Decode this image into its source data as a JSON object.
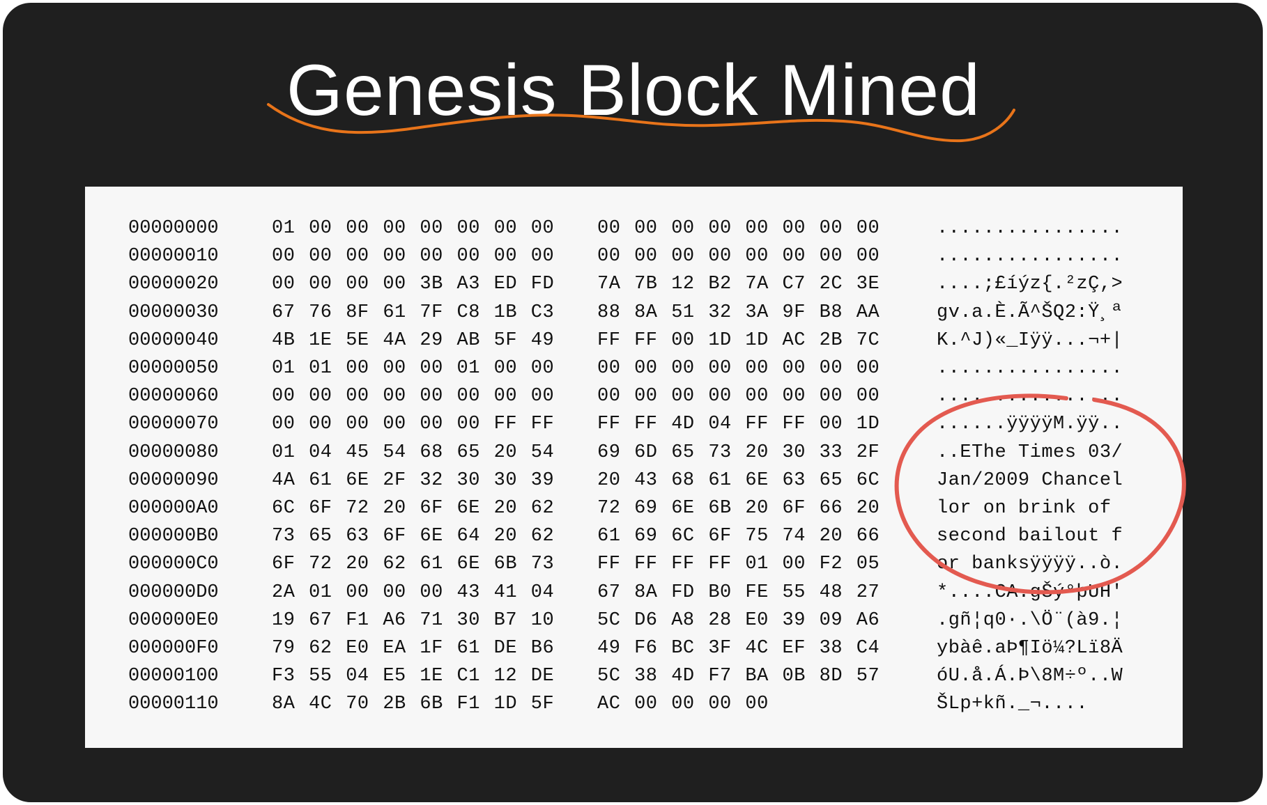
{
  "title": "Genesis Block Mined",
  "colors": {
    "background": "#1f1f1f",
    "title": "#ffffff",
    "underline_accent": "#e8741a",
    "panel": "#f7f7f7",
    "highlight_circle": "#e35a50"
  },
  "hex_rows": [
    {
      "offset": "00000000",
      "bytes1": "01 00 00 00 00 00 00 00",
      "bytes2": "00 00 00 00 00 00 00 00",
      "ascii": "................"
    },
    {
      "offset": "00000010",
      "bytes1": "00 00 00 00 00 00 00 00",
      "bytes2": "00 00 00 00 00 00 00 00",
      "ascii": "................"
    },
    {
      "offset": "00000020",
      "bytes1": "00 00 00 00 3B A3 ED FD",
      "bytes2": "7A 7B 12 B2 7A C7 2C 3E",
      "ascii": "....;£íýz{.²zÇ,>"
    },
    {
      "offset": "00000030",
      "bytes1": "67 76 8F 61 7F C8 1B C3",
      "bytes2": "88 8A 51 32 3A 9F B8 AA",
      "ascii": "gv.a.È.Ã^ŠQ2:Ÿ¸ª"
    },
    {
      "offset": "00000040",
      "bytes1": "4B 1E 5E 4A 29 AB 5F 49",
      "bytes2": "FF FF 00 1D 1D AC 2B 7C",
      "ascii": "K.^J)«_Iÿÿ...¬+|"
    },
    {
      "offset": "00000050",
      "bytes1": "01 01 00 00 00 01 00 00",
      "bytes2": "00 00 00 00 00 00 00 00",
      "ascii": "................"
    },
    {
      "offset": "00000060",
      "bytes1": "00 00 00 00 00 00 00 00",
      "bytes2": "00 00 00 00 00 00 00 00",
      "ascii": "................"
    },
    {
      "offset": "00000070",
      "bytes1": "00 00 00 00 00 00 FF FF",
      "bytes2": "FF FF 4D 04 FF FF 00 1D",
      "ascii": "......ÿÿÿÿM.ÿÿ.."
    },
    {
      "offset": "00000080",
      "bytes1": "01 04 45 54 68 65 20 54",
      "bytes2": "69 6D 65 73 20 30 33 2F",
      "ascii": "..EThe Times 03/"
    },
    {
      "offset": "00000090",
      "bytes1": "4A 61 6E 2F 32 30 30 39",
      "bytes2": "20 43 68 61 6E 63 65 6C",
      "ascii": "Jan/2009 Chancel"
    },
    {
      "offset": "000000A0",
      "bytes1": "6C 6F 72 20 6F 6E 20 62",
      "bytes2": "72 69 6E 6B 20 6F 66 20",
      "ascii": "lor on brink of "
    },
    {
      "offset": "000000B0",
      "bytes1": "73 65 63 6F 6E 64 20 62",
      "bytes2": "61 69 6C 6F 75 74 20 66",
      "ascii": "second bailout f"
    },
    {
      "offset": "000000C0",
      "bytes1": "6F 72 20 62 61 6E 6B 73",
      "bytes2": "FF FF FF FF 01 00 F2 05",
      "ascii": "or banksÿÿÿÿ..ò."
    },
    {
      "offset": "000000D0",
      "bytes1": "2A 01 00 00 00 43 41 04",
      "bytes2": "67 8A FD B0 FE 55 48 27",
      "ascii": "*....CA.gŠý°þUH'"
    },
    {
      "offset": "000000E0",
      "bytes1": "19 67 F1 A6 71 30 B7 10",
      "bytes2": "5C D6 A8 28 E0 39 09 A6",
      "ascii": ".gñ¦q0·.\\Ö¨(à9.¦"
    },
    {
      "offset": "000000F0",
      "bytes1": "79 62 E0 EA 1F 61 DE B6",
      "bytes2": "49 F6 BC 3F 4C EF 38 C4",
      "ascii": "ybàê.aÞ¶Iö¼?Lï8Ä"
    },
    {
      "offset": "00000100",
      "bytes1": "F3 55 04 E5 1E C1 12 DE",
      "bytes2": "5C 38 4D F7 BA 0B 8D 57",
      "ascii": "óU.å.Á.Þ\\8M÷º..W"
    },
    {
      "offset": "00000110",
      "bytes1": "8A 4C 70 2B 6B F1 1D 5F",
      "bytes2": "AC 00 00 00 00",
      "ascii": "ŠLp+kñ._¬...."
    }
  ]
}
